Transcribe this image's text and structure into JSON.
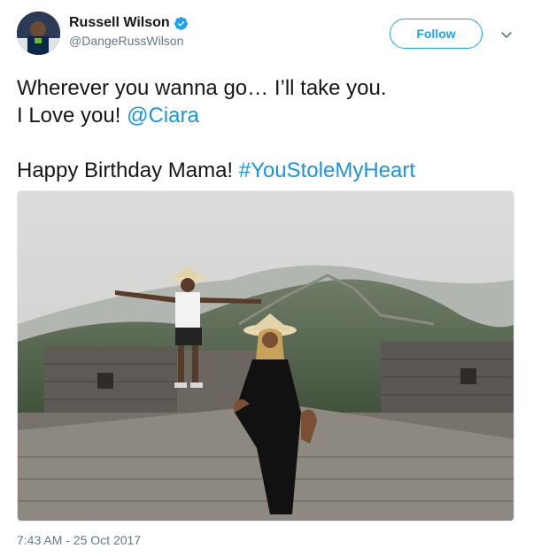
{
  "user": {
    "display_name": "Russell Wilson",
    "handle": "@DangeRussWilson",
    "verified": true
  },
  "actions": {
    "follow_label": "Follow"
  },
  "tweet": {
    "line1": "Wherever you wanna go… I’ll take you.",
    "line2_text": "I Love you! ",
    "mention": "@Ciara",
    "line3_text": "Happy Birthday Mama! ",
    "hashtag": "#YouStoleMyHeart"
  },
  "timestamp": "7:43 AM - 25 Oct 2017",
  "colors": {
    "link": "#1b95e0",
    "follow": "#1da1f2",
    "muted": "#657786"
  }
}
